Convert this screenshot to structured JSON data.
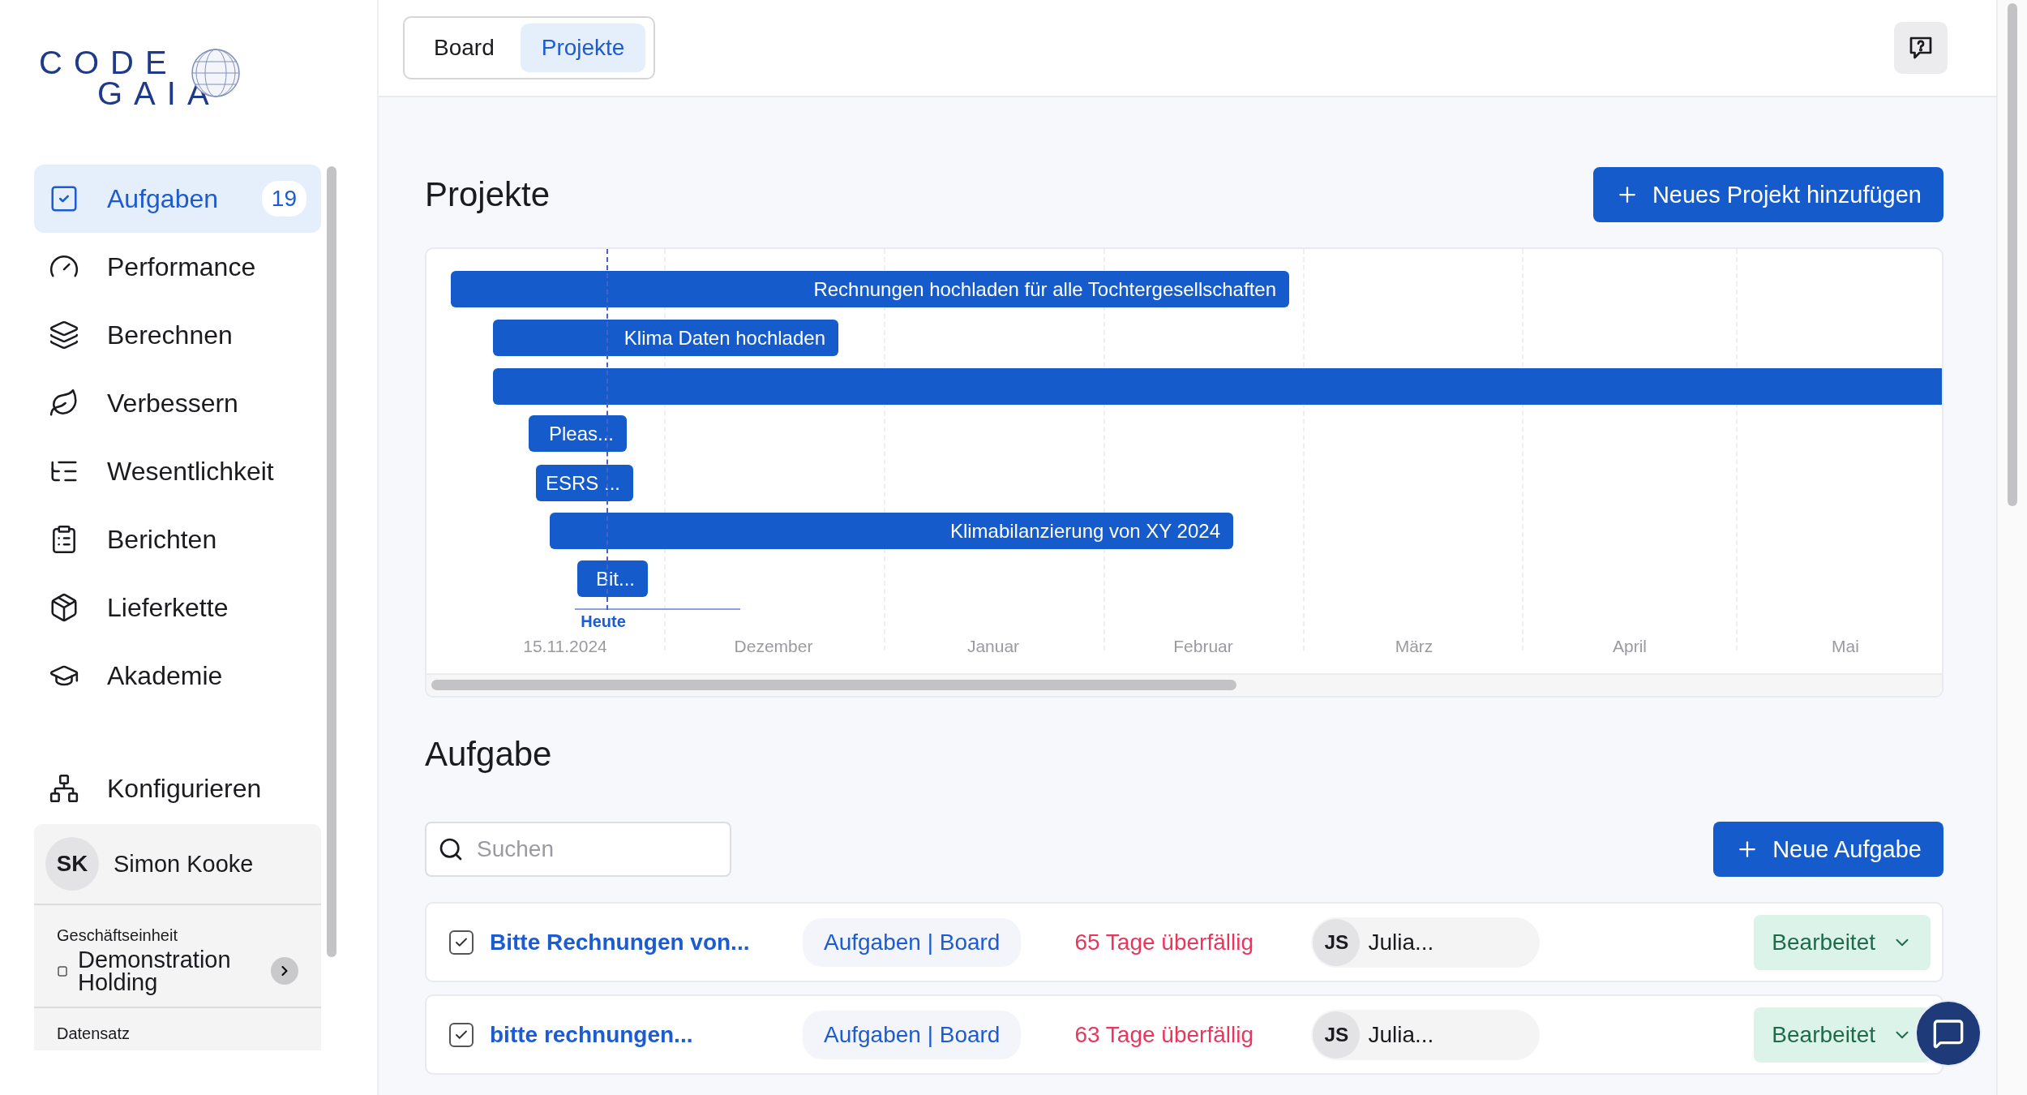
{
  "logo": {
    "top": "CODE",
    "bottom": "GAIA"
  },
  "sidebar": {
    "items": [
      {
        "label": "Aufgaben",
        "selected": true,
        "badge": "19"
      },
      {
        "label": "Performance",
        "selected": false
      },
      {
        "label": "Berechnen",
        "selected": false
      },
      {
        "label": "Verbessern",
        "selected": false
      },
      {
        "label": "Wesentlichkeit",
        "selected": false
      },
      {
        "label": "Berichten",
        "selected": false
      },
      {
        "label": "Lieferkette",
        "selected": false
      },
      {
        "label": "Akademie",
        "selected": false
      }
    ],
    "config": {
      "label": "Konfigurieren"
    },
    "user": {
      "initials": "SK",
      "name": "Simon Kooke"
    },
    "business_unit": {
      "label": "Geschäftseinheit",
      "value": "Demonstration Holding"
    },
    "dataset": {
      "label": "Datensatz"
    }
  },
  "tabs": [
    {
      "label": "Board",
      "selected": false
    },
    {
      "label": "Projekte",
      "selected": true
    }
  ],
  "projects": {
    "title": "Projekte",
    "add_button": "Neues Projekt hinzufügen",
    "bars": [
      {
        "kind": "labeled",
        "label": "Rechnungen hochladen für alle Tochtergesellschaften"
      },
      {
        "kind": "labeled",
        "label": "Klima Daten hochladen"
      },
      {
        "kind": "plain"
      },
      {
        "kind": "labeled",
        "label": "Pleas..."
      },
      {
        "kind": "labeled",
        "label": "ESRS ..."
      },
      {
        "kind": "labeled",
        "label": "Klimabilanzierung von XY 2024"
      },
      {
        "kind": "labeled",
        "label": "Bit..."
      }
    ],
    "today_label": "Heute",
    "start_date": "15.11.2024",
    "months": [
      "Dezember",
      "Januar",
      "Februar",
      "März",
      "April",
      "Mai"
    ]
  },
  "tasks": {
    "title": "Aufgabe",
    "search": {
      "placeholder": "Suchen"
    },
    "add_button": "Neue Aufgabe",
    "rows": [
      {
        "checked": true,
        "title": "Bitte Rechnungen von...",
        "tag": "Aufgaben | Board",
        "due": "65 Tage überfällig",
        "assignee": {
          "initials": "JS",
          "name": "Julia..."
        },
        "status": "Bearbeitet"
      },
      {
        "checked": true,
        "title": "bitte rechnungen...",
        "tag": "Aufgaben | Board",
        "due": "63 Tage überfällig",
        "assignee": {
          "initials": "JS",
          "name": "Julia..."
        },
        "status": "Bearbeitet"
      }
    ]
  }
}
